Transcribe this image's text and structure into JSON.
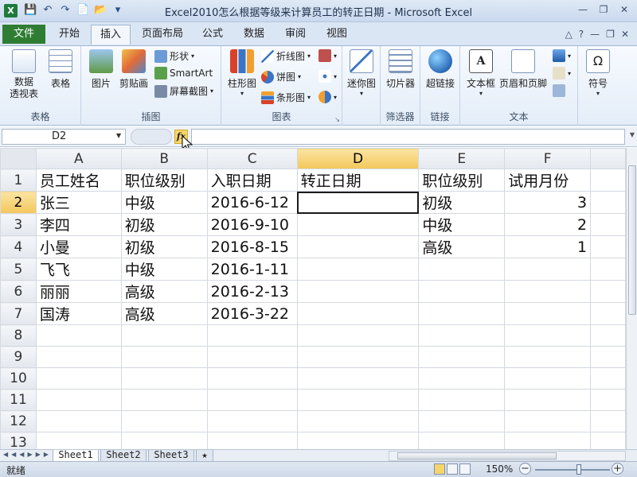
{
  "window": {
    "title": "Excel2010怎么根据等级来计算员工的转正日期 - Microsoft Excel",
    "app_icon_letter": "X"
  },
  "tabs": {
    "file": "文件",
    "items": [
      "开始",
      "插入",
      "页面布局",
      "公式",
      "数据",
      "审阅",
      "视图"
    ],
    "active": "插入"
  },
  "ribbon": {
    "groups": {
      "tables": {
        "label": "表格",
        "pivot": "数据\n透视表",
        "table": "表格"
      },
      "illustrations": {
        "label": "插图",
        "picture": "图片",
        "clipart": "剪贴画",
        "shapes": "形状",
        "smartart": "SmartArt",
        "screenshot": "屏幕截图"
      },
      "charts": {
        "label": "图表",
        "column": "柱形图",
        "line": "折线图",
        "pie": "饼图",
        "bar": "条形图"
      },
      "sparklines": {
        "label": "",
        "sparkline": "迷你图"
      },
      "filters": {
        "label": "筛选器",
        "slicer": "切片器"
      },
      "links": {
        "label": "链接",
        "hyperlink": "超链接"
      },
      "text": {
        "label": "文本",
        "textbox": "文本框",
        "headerfooter": "页眉和页脚"
      },
      "symbols": {
        "label": "",
        "symbol": "符号"
      }
    }
  },
  "formula_bar": {
    "name_box": "D2",
    "fx_label": "fx",
    "formula": ""
  },
  "sheet": {
    "columns": [
      "A",
      "B",
      "C",
      "D",
      "E",
      "F"
    ],
    "selected_cell": "D2",
    "rows": [
      [
        "员工姓名",
        "职位级别",
        "入职日期",
        "转正日期",
        "职位级别",
        "试用月份"
      ],
      [
        "张三",
        "中级",
        "2016-6-12",
        "",
        "初级",
        "3"
      ],
      [
        "李四",
        "初级",
        "2016-9-10",
        "",
        "中级",
        "2"
      ],
      [
        "小曼",
        "初级",
        "2016-8-15",
        "",
        "高级",
        "1"
      ],
      [
        "飞飞",
        "中级",
        "2016-1-11",
        "",
        "",
        ""
      ],
      [
        "丽丽",
        "高级",
        "2016-2-13",
        "",
        "",
        ""
      ],
      [
        "国涛",
        "高级",
        "2016-3-22",
        "",
        "",
        ""
      ],
      [
        "",
        "",
        "",
        "",
        "",
        ""
      ],
      [
        "",
        "",
        "",
        "",
        "",
        ""
      ],
      [
        "",
        "",
        "",
        "",
        "",
        ""
      ],
      [
        "",
        "",
        "",
        "",
        "",
        ""
      ],
      [
        "",
        "",
        "",
        "",
        "",
        ""
      ],
      [
        "",
        "",
        "",
        "",
        "",
        ""
      ]
    ],
    "row_numbers": [
      "1",
      "2",
      "3",
      "4",
      "5",
      "6",
      "7",
      "8",
      "9",
      "10",
      "11",
      "12",
      "13"
    ]
  },
  "sheet_tabs": [
    "Sheet1",
    "Sheet2",
    "Sheet3"
  ],
  "active_sheet": "Sheet1",
  "status": {
    "mode": "就绪",
    "zoom": "150%",
    "zoom_value": 1.5
  },
  "colors": {
    "file_tab": "#2e7d32",
    "active_header": "#f3c75a",
    "fx_button": "#f6d66a"
  }
}
